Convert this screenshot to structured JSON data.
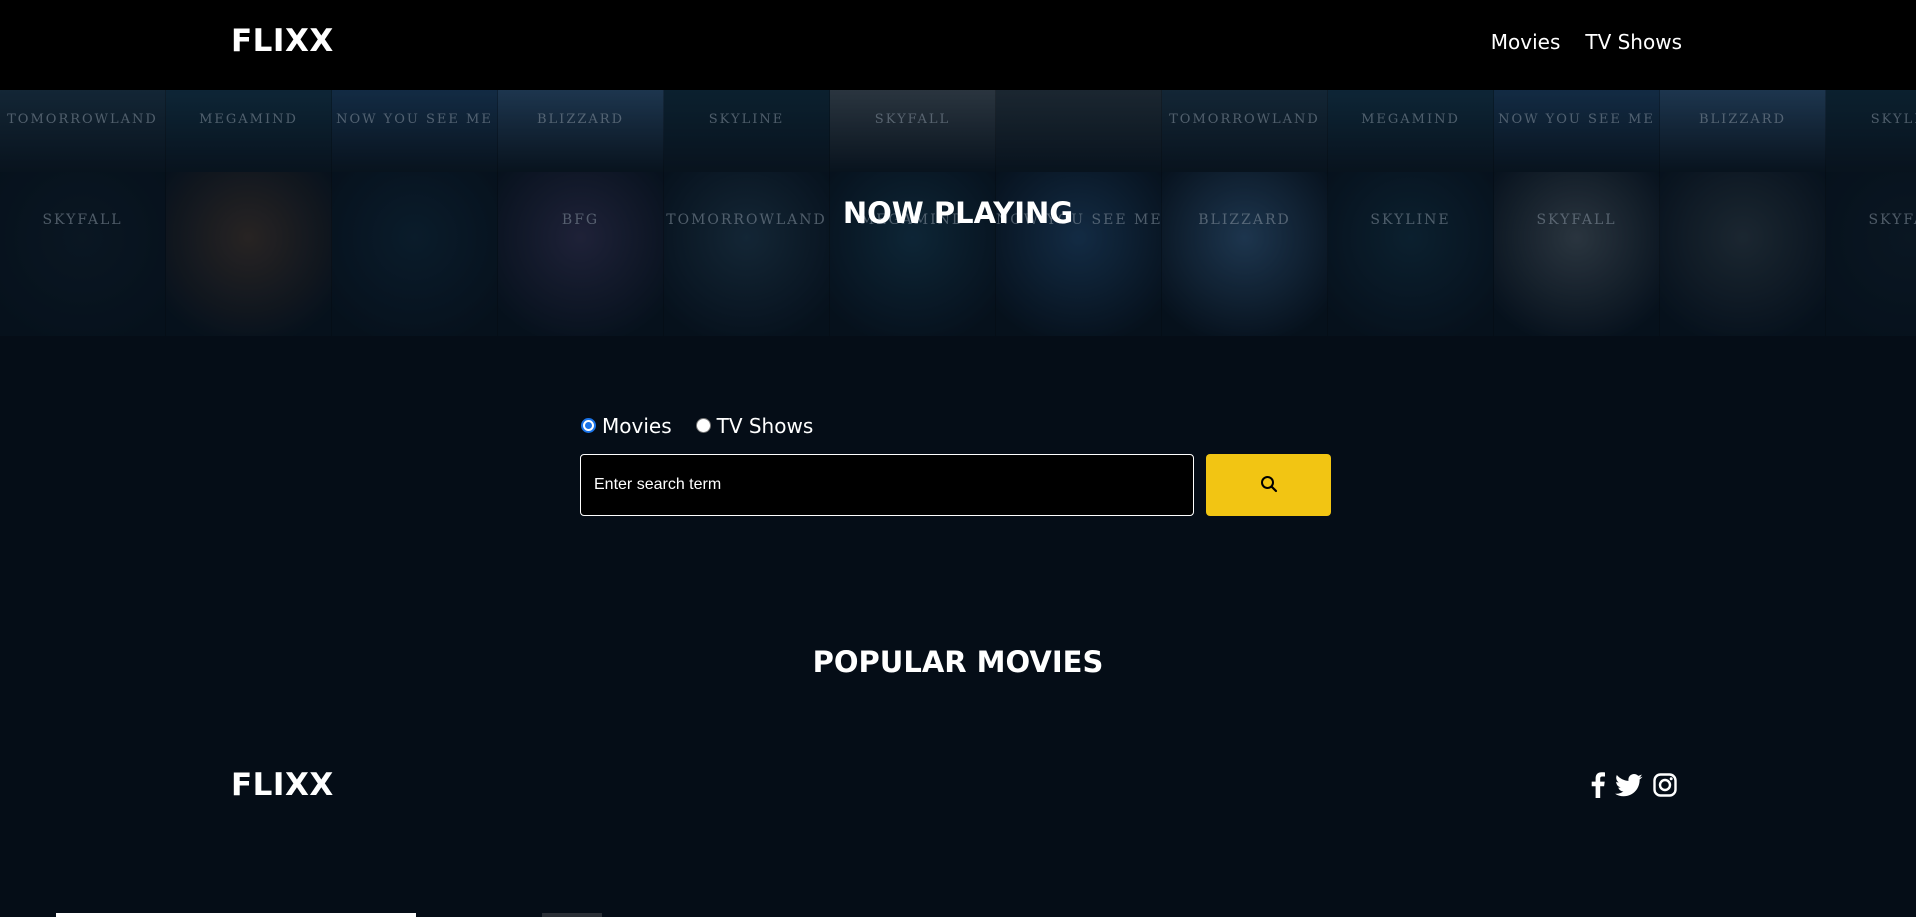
{
  "header": {
    "brand": "FLIXX",
    "nav": [
      {
        "label": "Movies"
      },
      {
        "label": "TV Shows"
      }
    ]
  },
  "hero": {
    "title": "NOW PLAYING",
    "posters": [
      {
        "label": "TOMORROWLAND",
        "color": "#1b3346"
      },
      {
        "label": "MEGAMIND",
        "color": "#123247"
      },
      {
        "label": "NOW YOU SEE ME",
        "color": "#1a3b5c"
      },
      {
        "label": "BLIZZARD",
        "color": "#2a4b6c"
      },
      {
        "label": "SKYLINE",
        "color": "#0f2a3c"
      },
      {
        "label": "SKYFALL",
        "color": "#3e4a55"
      },
      {
        "label": "",
        "color": "#27343f"
      },
      {
        "label": "SKYFALL",
        "color": "#0d1c29"
      },
      {
        "label": "",
        "color": "#3a2f2a"
      },
      {
        "label": "",
        "color": "#0d2436"
      },
      {
        "label": "BFG",
        "color": "#2c2c4a"
      }
    ]
  },
  "search": {
    "type_options": [
      {
        "label": "Movies",
        "checked": true
      },
      {
        "label": "TV Shows",
        "checked": false
      }
    ],
    "placeholder": "Enter search term",
    "button_icon": "search-icon"
  },
  "popular": {
    "title": "POPULAR MOVIES"
  },
  "footer": {
    "brand": "FLIXX",
    "social_icons": [
      "facebook-icon",
      "twitter-icon",
      "instagram-icon"
    ]
  },
  "colors": {
    "background": "#050d17",
    "header": "#000000",
    "accent": "#f2c513",
    "radio_accent": "#1a73e8"
  }
}
